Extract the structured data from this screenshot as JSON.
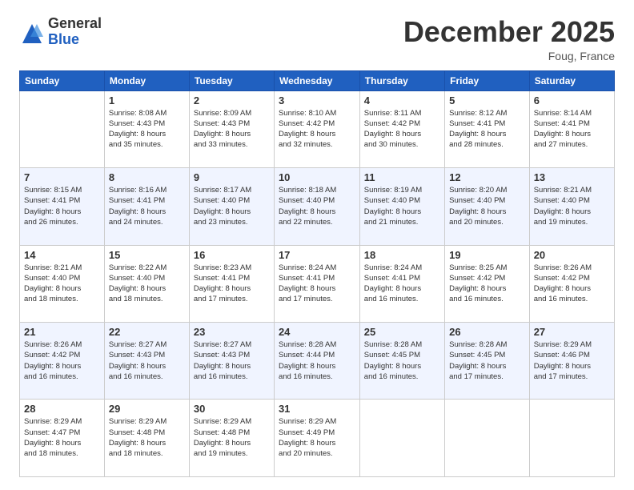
{
  "header": {
    "logo_general": "General",
    "logo_blue": "Blue",
    "month": "December 2025",
    "location": "Foug, France"
  },
  "days_of_week": [
    "Sunday",
    "Monday",
    "Tuesday",
    "Wednesday",
    "Thursday",
    "Friday",
    "Saturday"
  ],
  "weeks": [
    [
      {
        "day": "",
        "info": ""
      },
      {
        "day": "1",
        "info": "Sunrise: 8:08 AM\nSunset: 4:43 PM\nDaylight: 8 hours\nand 35 minutes."
      },
      {
        "day": "2",
        "info": "Sunrise: 8:09 AM\nSunset: 4:43 PM\nDaylight: 8 hours\nand 33 minutes."
      },
      {
        "day": "3",
        "info": "Sunrise: 8:10 AM\nSunset: 4:42 PM\nDaylight: 8 hours\nand 32 minutes."
      },
      {
        "day": "4",
        "info": "Sunrise: 8:11 AM\nSunset: 4:42 PM\nDaylight: 8 hours\nand 30 minutes."
      },
      {
        "day": "5",
        "info": "Sunrise: 8:12 AM\nSunset: 4:41 PM\nDaylight: 8 hours\nand 28 minutes."
      },
      {
        "day": "6",
        "info": "Sunrise: 8:14 AM\nSunset: 4:41 PM\nDaylight: 8 hours\nand 27 minutes."
      }
    ],
    [
      {
        "day": "7",
        "info": "Sunrise: 8:15 AM\nSunset: 4:41 PM\nDaylight: 8 hours\nand 26 minutes."
      },
      {
        "day": "8",
        "info": "Sunrise: 8:16 AM\nSunset: 4:41 PM\nDaylight: 8 hours\nand 24 minutes."
      },
      {
        "day": "9",
        "info": "Sunrise: 8:17 AM\nSunset: 4:40 PM\nDaylight: 8 hours\nand 23 minutes."
      },
      {
        "day": "10",
        "info": "Sunrise: 8:18 AM\nSunset: 4:40 PM\nDaylight: 8 hours\nand 22 minutes."
      },
      {
        "day": "11",
        "info": "Sunrise: 8:19 AM\nSunset: 4:40 PM\nDaylight: 8 hours\nand 21 minutes."
      },
      {
        "day": "12",
        "info": "Sunrise: 8:20 AM\nSunset: 4:40 PM\nDaylight: 8 hours\nand 20 minutes."
      },
      {
        "day": "13",
        "info": "Sunrise: 8:21 AM\nSunset: 4:40 PM\nDaylight: 8 hours\nand 19 minutes."
      }
    ],
    [
      {
        "day": "14",
        "info": "Sunrise: 8:21 AM\nSunset: 4:40 PM\nDaylight: 8 hours\nand 18 minutes."
      },
      {
        "day": "15",
        "info": "Sunrise: 8:22 AM\nSunset: 4:40 PM\nDaylight: 8 hours\nand 18 minutes."
      },
      {
        "day": "16",
        "info": "Sunrise: 8:23 AM\nSunset: 4:41 PM\nDaylight: 8 hours\nand 17 minutes."
      },
      {
        "day": "17",
        "info": "Sunrise: 8:24 AM\nSunset: 4:41 PM\nDaylight: 8 hours\nand 17 minutes."
      },
      {
        "day": "18",
        "info": "Sunrise: 8:24 AM\nSunset: 4:41 PM\nDaylight: 8 hours\nand 16 minutes."
      },
      {
        "day": "19",
        "info": "Sunrise: 8:25 AM\nSunset: 4:42 PM\nDaylight: 8 hours\nand 16 minutes."
      },
      {
        "day": "20",
        "info": "Sunrise: 8:26 AM\nSunset: 4:42 PM\nDaylight: 8 hours\nand 16 minutes."
      }
    ],
    [
      {
        "day": "21",
        "info": "Sunrise: 8:26 AM\nSunset: 4:42 PM\nDaylight: 8 hours\nand 16 minutes."
      },
      {
        "day": "22",
        "info": "Sunrise: 8:27 AM\nSunset: 4:43 PM\nDaylight: 8 hours\nand 16 minutes."
      },
      {
        "day": "23",
        "info": "Sunrise: 8:27 AM\nSunset: 4:43 PM\nDaylight: 8 hours\nand 16 minutes."
      },
      {
        "day": "24",
        "info": "Sunrise: 8:28 AM\nSunset: 4:44 PM\nDaylight: 8 hours\nand 16 minutes."
      },
      {
        "day": "25",
        "info": "Sunrise: 8:28 AM\nSunset: 4:45 PM\nDaylight: 8 hours\nand 16 minutes."
      },
      {
        "day": "26",
        "info": "Sunrise: 8:28 AM\nSunset: 4:45 PM\nDaylight: 8 hours\nand 17 minutes."
      },
      {
        "day": "27",
        "info": "Sunrise: 8:29 AM\nSunset: 4:46 PM\nDaylight: 8 hours\nand 17 minutes."
      }
    ],
    [
      {
        "day": "28",
        "info": "Sunrise: 8:29 AM\nSunset: 4:47 PM\nDaylight: 8 hours\nand 18 minutes."
      },
      {
        "day": "29",
        "info": "Sunrise: 8:29 AM\nSunset: 4:48 PM\nDaylight: 8 hours\nand 18 minutes."
      },
      {
        "day": "30",
        "info": "Sunrise: 8:29 AM\nSunset: 4:48 PM\nDaylight: 8 hours\nand 19 minutes."
      },
      {
        "day": "31",
        "info": "Sunrise: 8:29 AM\nSunset: 4:49 PM\nDaylight: 8 hours\nand 20 minutes."
      },
      {
        "day": "",
        "info": ""
      },
      {
        "day": "",
        "info": ""
      },
      {
        "day": "",
        "info": ""
      }
    ]
  ]
}
